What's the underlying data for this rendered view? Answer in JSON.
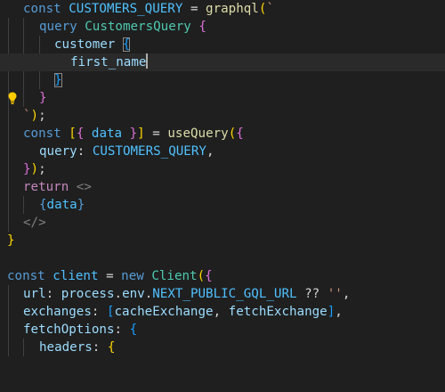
{
  "colors": {
    "background": "#1f1f1f",
    "current_line": "#2a2a2a",
    "keyword_blue": "#569cd6",
    "keyword_purple": "#c586c0",
    "constant": "#4fc1ff",
    "function": "#dcdcaa",
    "class": "#4ec9b0",
    "variable": "#9cdcfe",
    "string": "#ce9178",
    "bracket_gold": "#ffd700",
    "bracket_orchid": "#da70d6",
    "bracket_blue": "#179fff",
    "lightbulb": "#ffcc00"
  },
  "icons": {
    "code_action": "lightbulb-icon"
  },
  "code": {
    "l1": {
      "kw": "const",
      "name": "CUSTOMERS_QUERY",
      "eq": "=",
      "fn": "graphql",
      "paren": "(",
      "tick": "`"
    },
    "l2": {
      "kw": "query",
      "name": "CustomersQuery",
      "brace": "{"
    },
    "l3": {
      "field": "customer",
      "brace": "{"
    },
    "l4": {
      "field": "first_name"
    },
    "l5": {
      "brace": "}"
    },
    "l6": {
      "brace": "}"
    },
    "l7": {
      "tick": "`",
      "paren": ")",
      "semi": ";"
    },
    "l8": {
      "kw": "const",
      "open_bracket": "[",
      "open_brace": "{",
      "data": "data",
      "close_brace": "}",
      "close_bracket": "]",
      "eq": "=",
      "fn": "useQuery",
      "paren": "(",
      "brace": "{"
    },
    "l9": {
      "key": "query",
      "colon": ":",
      "value": "CUSTOMERS_QUERY",
      "comma": ","
    },
    "l10": {
      "brace": "}",
      "paren": ")",
      "semi": ";"
    },
    "l11": {
      "kw": "return",
      "fragment": "<>"
    },
    "l12": {
      "open": "{",
      "data": "data",
      "close": "}"
    },
    "l13": {
      "fragment_close": "</>"
    },
    "l14": {
      "brace": "}"
    },
    "l16": {
      "kw": "const",
      "name": "client",
      "eq": "=",
      "new": "new",
      "cls": "Client",
      "paren": "(",
      "brace": "{"
    },
    "l17": {
      "key": "url",
      "colon": ":",
      "obj": "process",
      "dot1": ".",
      "prop1": "env",
      "dot2": ".",
      "const": "NEXT_PUBLIC_GQL_URL",
      "op": "??",
      "str": "''",
      "comma": ","
    },
    "l18": {
      "key": "exchanges",
      "colon": ":",
      "open": "[",
      "a": "cacheExchange",
      "sep": ",",
      "b": "fetchExchange",
      "close": "]",
      "comma": ","
    },
    "l19": {
      "key": "fetchOptions",
      "colon": ":",
      "brace": "{"
    },
    "l20": {
      "key": "headers",
      "colon": ":",
      "brace": "{"
    }
  }
}
